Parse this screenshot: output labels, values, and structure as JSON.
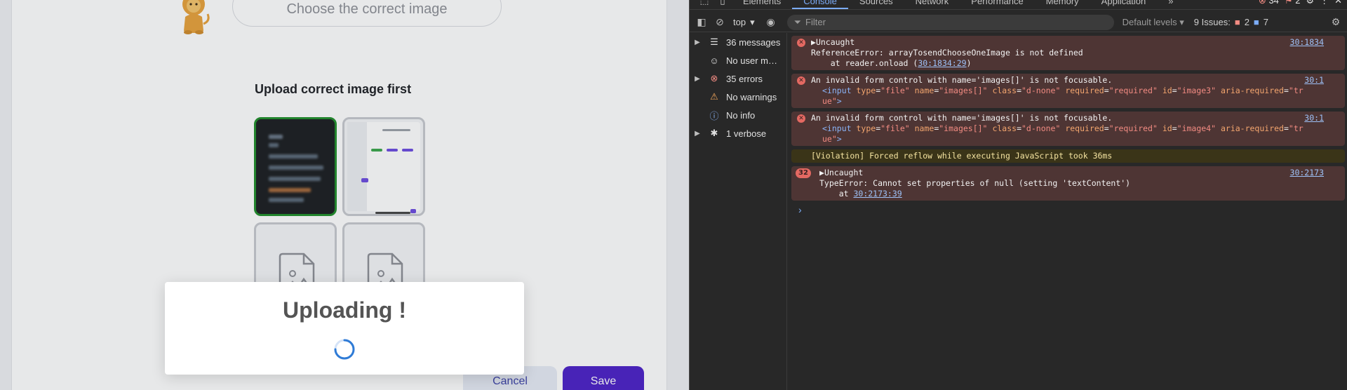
{
  "app": {
    "question_placeholder": "Choose the correct image",
    "upload_title": "Upload correct image first",
    "cancel_label": "Cancel",
    "save_label": "Save",
    "modal_title": "Uploading !"
  },
  "devtools": {
    "tabs": [
      "Elements",
      "Console",
      "Sources",
      "Network",
      "Performance",
      "Memory",
      "Application"
    ],
    "active_tab": "Console",
    "more_tabs": "»",
    "context": "top",
    "filter_placeholder": "Filter",
    "levels": "Default levels",
    "error_count": "34",
    "warning_count": "2",
    "issues_label": "9 Issues:",
    "issues_errors": "2",
    "issues_info": "7",
    "sidebar": [
      {
        "label": "36 messages",
        "icon": "list-icon",
        "expandable": true
      },
      {
        "label": "No user m…",
        "icon": "user-icon",
        "expandable": false
      },
      {
        "label": "35 errors",
        "icon": "error-icon",
        "expandable": true
      },
      {
        "label": "No warnings",
        "icon": "warning-icon",
        "expandable": false
      },
      {
        "label": "No info",
        "icon": "info-icon",
        "expandable": false
      },
      {
        "label": "1 verbose",
        "icon": "bug-icon",
        "expandable": true
      }
    ],
    "messages": {
      "m1": {
        "head": "Uncaught",
        "line2": "ReferenceError: arrayTosendChooseOneImage is not defined",
        "line3_pre": "    at reader.onload (",
        "line3_link": "30:1834:29",
        "line3_post": ")",
        "source": "30:1834"
      },
      "m2": {
        "text": "An invalid form control with name='images[]' is not focusable.",
        "source": "30:1",
        "id_val": "\"image3\""
      },
      "m3": {
        "text": "An invalid form control with name='images[]' is not focusable.",
        "source": "30:1",
        "id_val": "\"image4\""
      },
      "violation": "[Violation] Forced reflow while executing JavaScript took 36ms",
      "m4": {
        "count": "32",
        "head": "Uncaught",
        "line2": "TypeError: Cannot set properties of null (setting 'textContent')",
        "line3_pre": "    at ",
        "line3_link": "30:2173:39",
        "source": "30:2173"
      }
    },
    "input_tag": {
      "open": "<input",
      "type_attr": "type",
      "type_val": "\"file\"",
      "name_attr": "name",
      "name_val": "\"images[]\"",
      "class_attr": "class",
      "class_val": "\"d-none\"",
      "required_attr": "required",
      "required_val": "\"required\"",
      "id_attr": "id",
      "aria_attr": "aria-required",
      "aria_val_a": "\"tr",
      "aria_val_b": "ue\"",
      "close": ">"
    },
    "prompt": "›"
  }
}
